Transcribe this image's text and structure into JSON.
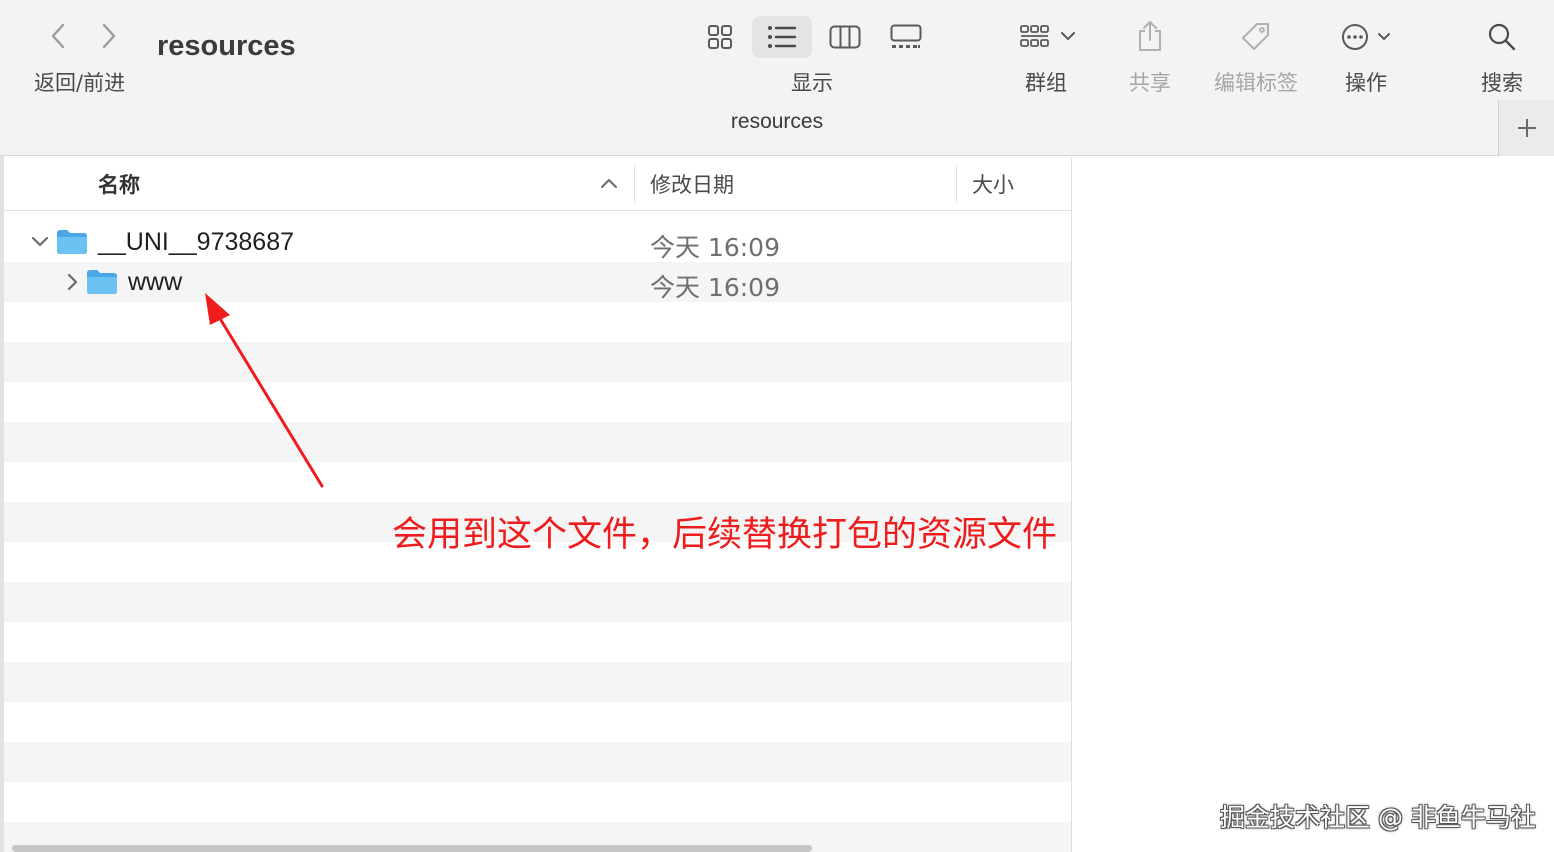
{
  "toolbar": {
    "nav_label": "返回/前进",
    "window_title": "resources",
    "view_label": "显示",
    "group_label": "群组",
    "share_label": "共享",
    "tags_label": "编辑标签",
    "action_label": "操作",
    "search_label": "搜索",
    "active_view": "list"
  },
  "path_bar": {
    "title": "resources"
  },
  "columns": {
    "name": "名称",
    "modified": "修改日期",
    "size": "大小",
    "sort": "ascending"
  },
  "files": [
    {
      "name": "__UNI__9738687",
      "modified": "今天 16:09",
      "expanded": true,
      "indent": 0
    },
    {
      "name": "www",
      "modified": "今天 16:09",
      "expanded": false,
      "indent": 1
    }
  ],
  "annotation": {
    "text": "会用到这个文件，后续替换打包的资源文件",
    "color": "#ee1c1c"
  },
  "watermark": "掘金技术社区 @ 非鱼牛马社",
  "colors": {
    "folder": "#5ab4ec",
    "stripe": "#f5f5f5",
    "toolbar_bg": "#f3f3f3"
  }
}
